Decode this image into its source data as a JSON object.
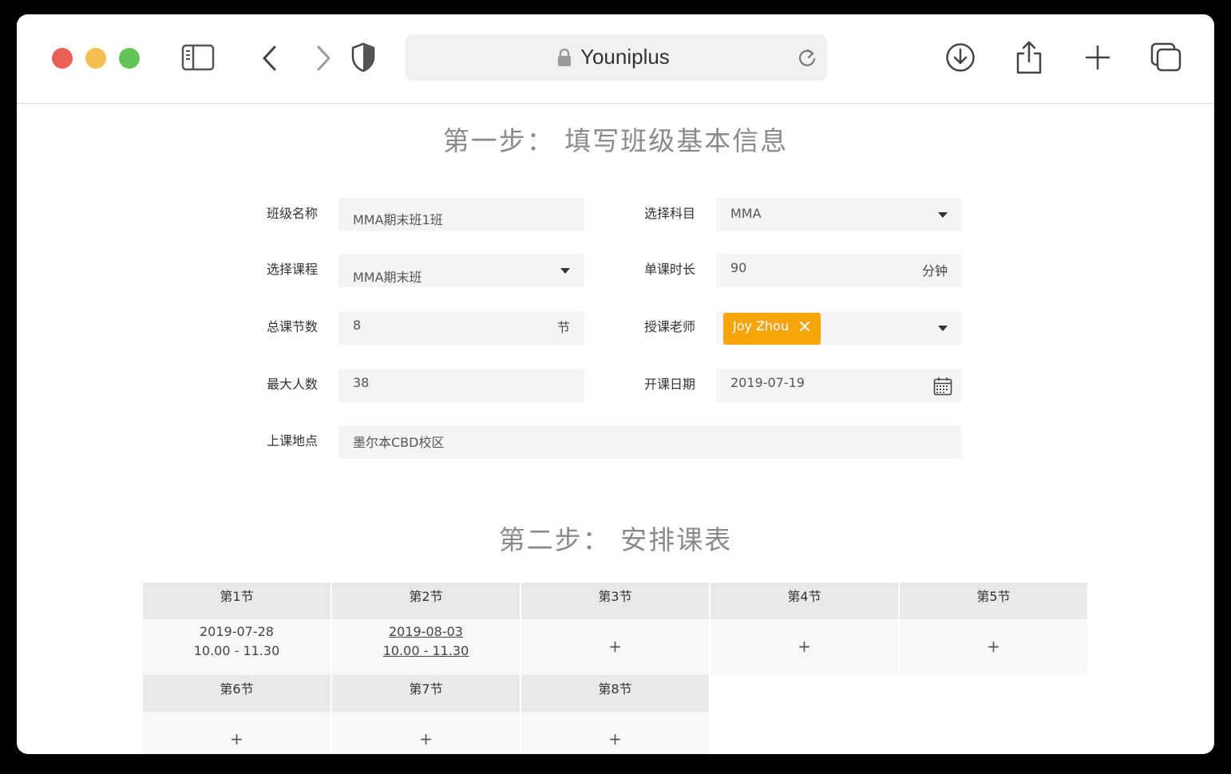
{
  "browser": {
    "url_title": "Youniplus"
  },
  "step1": {
    "title": "第一步：  填写班级基本信息",
    "fields": {
      "class_name": {
        "label": "班级名称",
        "value": "MMA期末班1班"
      },
      "subject": {
        "label": "选择科目",
        "value": "MMA"
      },
      "course": {
        "label": "选择课程",
        "value": "MMA期末班"
      },
      "duration": {
        "label": "单课时长",
        "value": "90",
        "unit": "分钟"
      },
      "total_lessons": {
        "label": "总课节数",
        "value": "8",
        "unit": "节"
      },
      "teacher": {
        "label": "授课老师",
        "tag": "Joy Zhou"
      },
      "max_students": {
        "label": "最大人数",
        "value": "38"
      },
      "start_date": {
        "label": "开课日期",
        "value": "2019-07-19"
      },
      "location": {
        "label": "上课地点",
        "value": "墨尔本CBD校区"
      }
    }
  },
  "step2": {
    "title": "第二步：  安排课表",
    "lessons": [
      {
        "label": "第1节",
        "date": "2019-07-28",
        "time": "10.00 - 11.30",
        "plus": ""
      },
      {
        "label": "第2节",
        "date": "2019-08-03",
        "time": "10.00 - 11.30",
        "plus": ""
      },
      {
        "label": "第3节",
        "date": "",
        "time": "",
        "plus": "+"
      },
      {
        "label": "第4节",
        "date": "",
        "time": "",
        "plus": "+"
      },
      {
        "label": "第5节",
        "date": "",
        "time": "",
        "plus": "+"
      },
      {
        "label": "第6节",
        "date": "",
        "time": "",
        "plus": "+"
      },
      {
        "label": "第7节",
        "date": "",
        "time": "",
        "plus": "+"
      },
      {
        "label": "第8节",
        "date": "",
        "time": "",
        "plus": "+"
      }
    ]
  },
  "colors": {
    "accent_tag": "#f7a30a",
    "field_bg": "#f4f4f4",
    "traffic_red": "#ec5f57",
    "traffic_yellow": "#f5bd4f",
    "traffic_green": "#62c454"
  },
  "icons": [
    "sidebar-icon",
    "back-icon",
    "forward-icon",
    "shield-icon",
    "lock-icon",
    "reload-icon",
    "download-icon",
    "share-icon",
    "new-tab-icon",
    "tabs-overview-icon",
    "caret-down-icon",
    "close-icon",
    "calendar-icon"
  ]
}
